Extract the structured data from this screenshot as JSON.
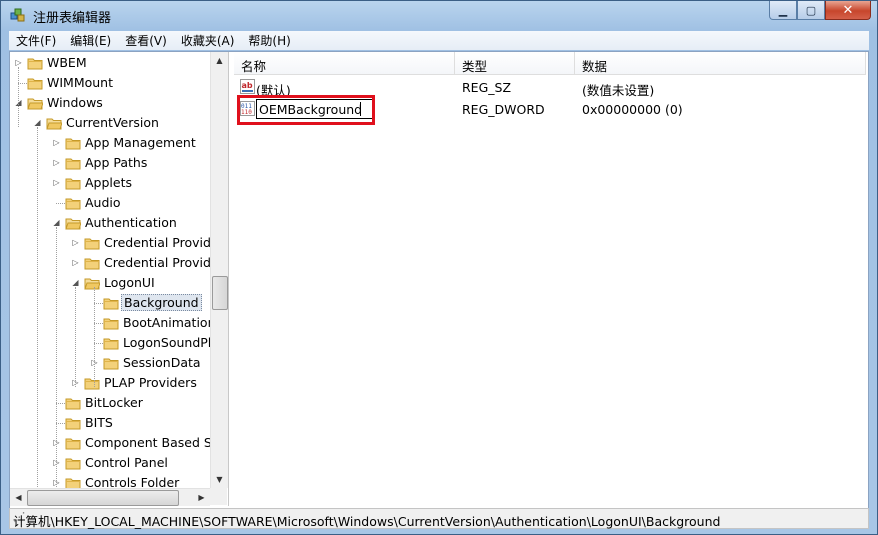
{
  "window": {
    "title": "注册表编辑器"
  },
  "menu": [
    "文件(F)",
    "编辑(E)",
    "查看(V)",
    "收藏夹(A)",
    "帮助(H)"
  ],
  "tree": [
    {
      "label": "WBEM",
      "depth": 0,
      "exp": "closed"
    },
    {
      "label": "WIMMount",
      "depth": 0,
      "exp": "none"
    },
    {
      "label": "Windows",
      "depth": 0,
      "exp": "open"
    },
    {
      "label": "CurrentVersion",
      "depth": 1,
      "exp": "open"
    },
    {
      "label": "App Management",
      "depth": 2,
      "exp": "closed"
    },
    {
      "label": "App Paths",
      "depth": 2,
      "exp": "closed"
    },
    {
      "label": "Applets",
      "depth": 2,
      "exp": "closed"
    },
    {
      "label": "Audio",
      "depth": 2,
      "exp": "none"
    },
    {
      "label": "Authentication",
      "depth": 2,
      "exp": "open"
    },
    {
      "label": "Credential Provide",
      "depth": 3,
      "exp": "closed"
    },
    {
      "label": "Credential Provide",
      "depth": 3,
      "exp": "closed"
    },
    {
      "label": "LogonUI",
      "depth": 3,
      "exp": "open"
    },
    {
      "label": "Background",
      "depth": 4,
      "exp": "none",
      "selected": true
    },
    {
      "label": "BootAnimation",
      "depth": 4,
      "exp": "none"
    },
    {
      "label": "LogonSoundPl",
      "depth": 4,
      "exp": "none"
    },
    {
      "label": "SessionData",
      "depth": 4,
      "exp": "closed"
    },
    {
      "label": "PLAP Providers",
      "depth": 3,
      "exp": "closed"
    },
    {
      "label": "BitLocker",
      "depth": 2,
      "exp": "none"
    },
    {
      "label": "BITS",
      "depth": 2,
      "exp": "none"
    },
    {
      "label": "Component Based Se",
      "depth": 2,
      "exp": "closed"
    },
    {
      "label": "Control Panel",
      "depth": 2,
      "exp": "closed"
    },
    {
      "label": "Controls Folder",
      "depth": 2,
      "exp": "closed"
    }
  ],
  "list": {
    "columns": [
      "名称",
      "类型",
      "数据"
    ],
    "rows": [
      {
        "name": "(默认)",
        "type": "REG_SZ",
        "data": "(数值未设置)",
        "icon": "string-value-icon"
      },
      {
        "name": "OEMBackground",
        "type": "REG_DWORD",
        "data": "0x00000000 (0)",
        "icon": "dword-value-icon",
        "editing": true
      }
    ]
  },
  "status": {
    "path": "计算机\\HKEY_LOCAL_MACHINE\\SOFTWARE\\Microsoft\\Windows\\CurrentVersion\\Authentication\\LogonUI\\Background"
  },
  "colors": {
    "highlight_box": "#e0101c",
    "folder": "#e8c46a"
  }
}
